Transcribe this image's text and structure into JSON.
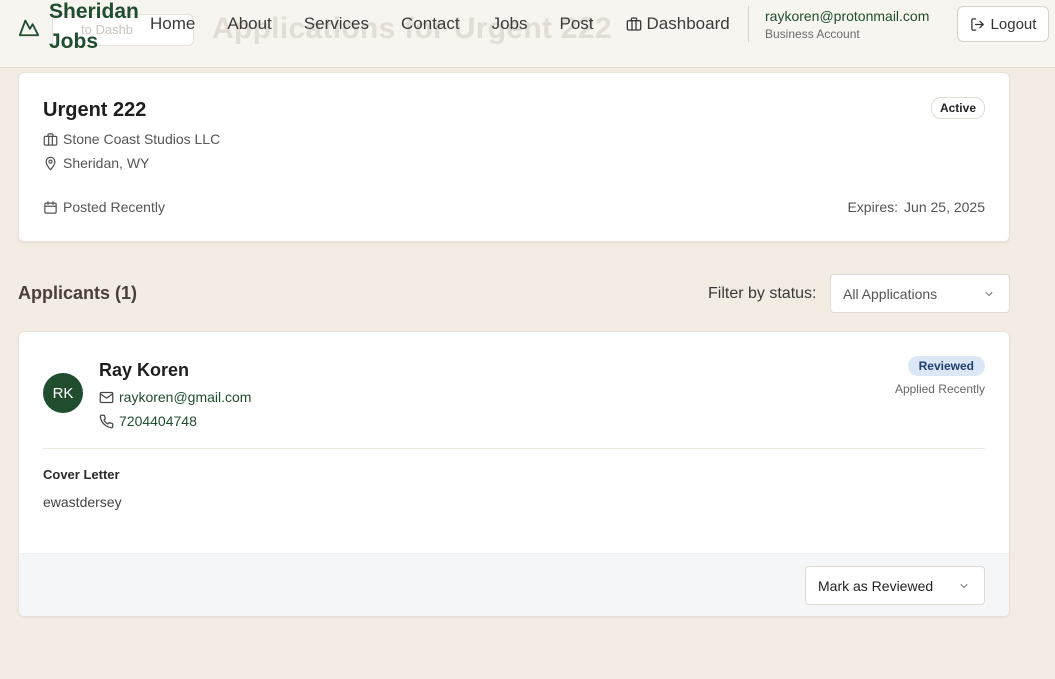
{
  "header": {
    "brand": "Sheridan Jobs",
    "ghost_back_label": "to Dashb",
    "ghost_page_title": "Applications for Urgent 222",
    "nav": [
      {
        "label": "Home"
      },
      {
        "label": "About"
      },
      {
        "label": "Services"
      },
      {
        "label": "Contact"
      },
      {
        "label": "Jobs"
      },
      {
        "label": "Post"
      },
      {
        "label": "Dashboard",
        "icon": "briefcase-icon"
      }
    ],
    "account": {
      "email": "raykoren@protonmail.com",
      "type": "Business Account"
    },
    "logout_label": "Logout"
  },
  "job": {
    "title": "Urgent 222",
    "status": "Active",
    "company": "Stone Coast Studios LLC",
    "location": "Sheridan, WY",
    "posted": "Posted Recently",
    "expires_label": "Expires:",
    "expires_date": "Jun 25, 2025"
  },
  "applicants": {
    "title": "Applicants (1)",
    "filter_label": "Filter by status:",
    "filter_value": "All Applications",
    "items": [
      {
        "initials": "RK",
        "name": "Ray Koren",
        "email": "raykoren@gmail.com",
        "phone": "7204404748",
        "status": "Reviewed",
        "applied": "Applied Recently",
        "cover_letter_label": "Cover Letter",
        "cover_letter": "ewastdersey",
        "action_value": "Mark as Reviewed"
      }
    ]
  },
  "colors": {
    "brand_green": "#1f4d2e",
    "page_bg": "#f2ece3",
    "reviewed_badge_bg": "#dbe7f7",
    "reviewed_badge_text": "#1f3f70"
  }
}
